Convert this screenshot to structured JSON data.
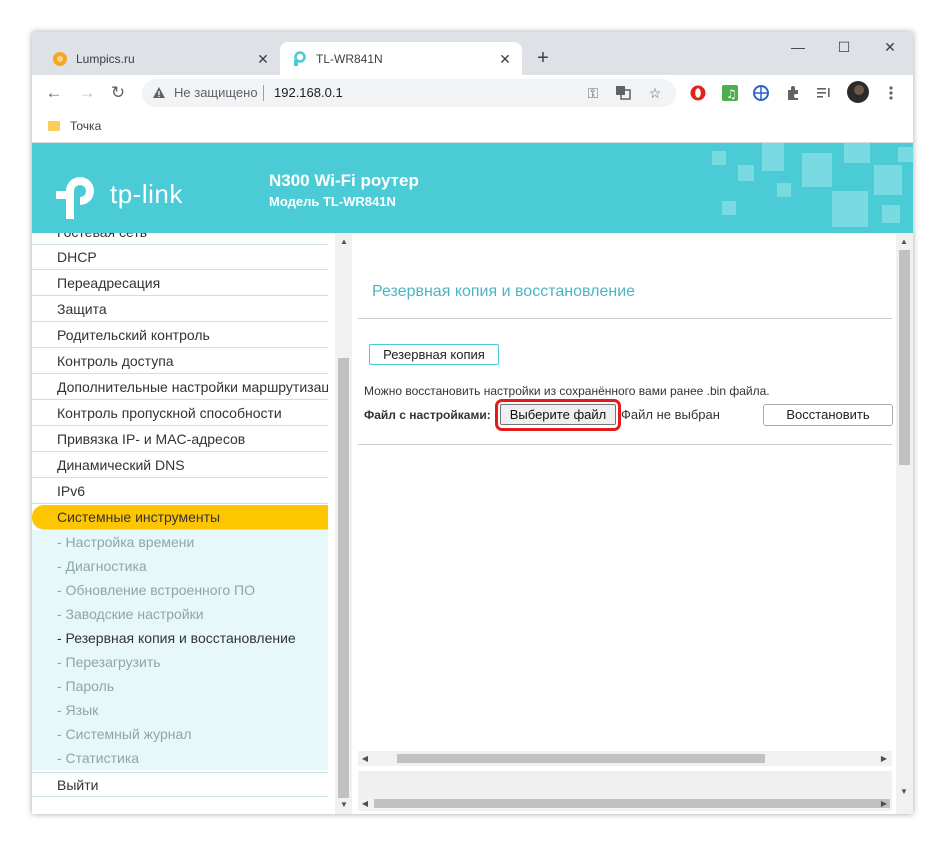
{
  "browser": {
    "tabs": [
      {
        "title": "Lumpics.ru",
        "icon": "orange-circle-favicon"
      },
      {
        "title": "TL-WR841N",
        "icon": "tplink-favicon"
      }
    ],
    "new_tab": "+",
    "window_controls": {
      "minimize": "—",
      "maximize": "☐",
      "close": "✕"
    },
    "address": {
      "security": "Не защищено",
      "url": "192.168.0.1"
    },
    "bookmark": "Точка"
  },
  "router": {
    "brand": "tp-link",
    "title": "N300 Wi-Fi роутер",
    "model": "Модель TL-WR841N"
  },
  "sidebar": {
    "items": [
      "Гостевая сеть",
      "DHCP",
      "Переадресация",
      "Защита",
      "Родительский контроль",
      "Контроль доступа",
      "Дополнительные настройки маршрутизации",
      "Контроль пропускной способности",
      "Привязка IP- и MAC-адресов",
      "Динамический DNS",
      "IPv6",
      "Системные инструменты"
    ],
    "subitems": [
      "- Настройка времени",
      "- Диагностика",
      "- Обновление встроенного ПО",
      "- Заводские настройки",
      "- Резервная копия и восстановление",
      "- Перезагрузить",
      "- Пароль",
      "- Язык",
      "- Системный журнал",
      "- Статистика"
    ],
    "logout": "Выйти"
  },
  "content": {
    "section_title": "Резервная копия и восстановление",
    "backup_button": "Резервная копия",
    "restore_hint": "Можно восстановить настройки из сохранённого вами ранее .bin файла.",
    "file_label": "Файл с настройками:",
    "choose_button": "Выберите файл",
    "no_file": "Файл не выбран",
    "restore_button": "Восстановить"
  },
  "colors": {
    "header": "#4acbd6",
    "active_menu": "#fdc600",
    "highlight": "#e31b1b"
  }
}
